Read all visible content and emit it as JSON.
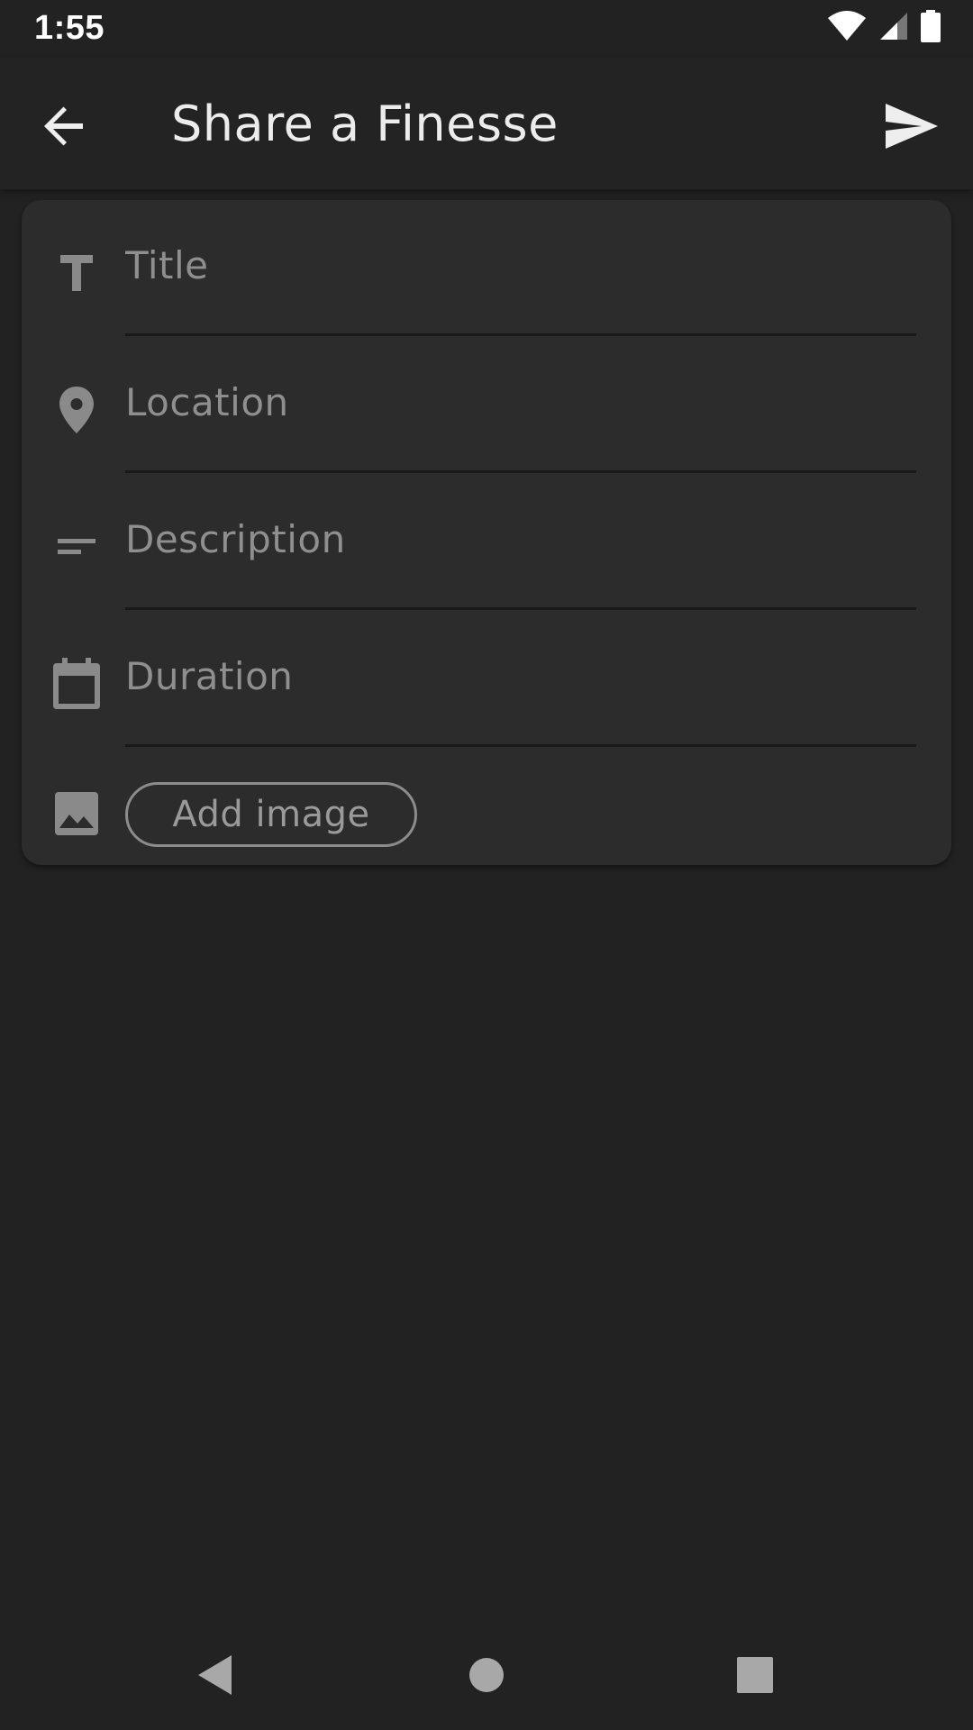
{
  "status_bar": {
    "time": "1:55",
    "icons": [
      "wifi-icon",
      "cell-signal-icon",
      "battery-icon"
    ]
  },
  "app_bar": {
    "title": "Share a Finesse",
    "back_icon": "arrow-back-icon",
    "send_icon": "send-icon"
  },
  "form": {
    "fields": [
      {
        "name": "title",
        "icon": "title-icon",
        "placeholder": "Title",
        "value": ""
      },
      {
        "name": "location",
        "icon": "location-pin-icon",
        "placeholder": "Location",
        "value": ""
      },
      {
        "name": "description",
        "icon": "description-icon",
        "placeholder": "Description",
        "value": ""
      },
      {
        "name": "duration",
        "icon": "calendar-icon",
        "placeholder": "Duration",
        "value": ""
      }
    ],
    "add_image": {
      "icon": "image-icon",
      "label": "Add image"
    }
  },
  "nav_bar": {
    "buttons": [
      "nav-back-icon",
      "nav-home-icon",
      "nav-recents-icon"
    ]
  },
  "colors": {
    "background": "#222222",
    "card": "#2c2c2c",
    "icon_gray": "#8a8a8a",
    "placeholder": "#8f8f8f",
    "title_text": "#ececec"
  }
}
